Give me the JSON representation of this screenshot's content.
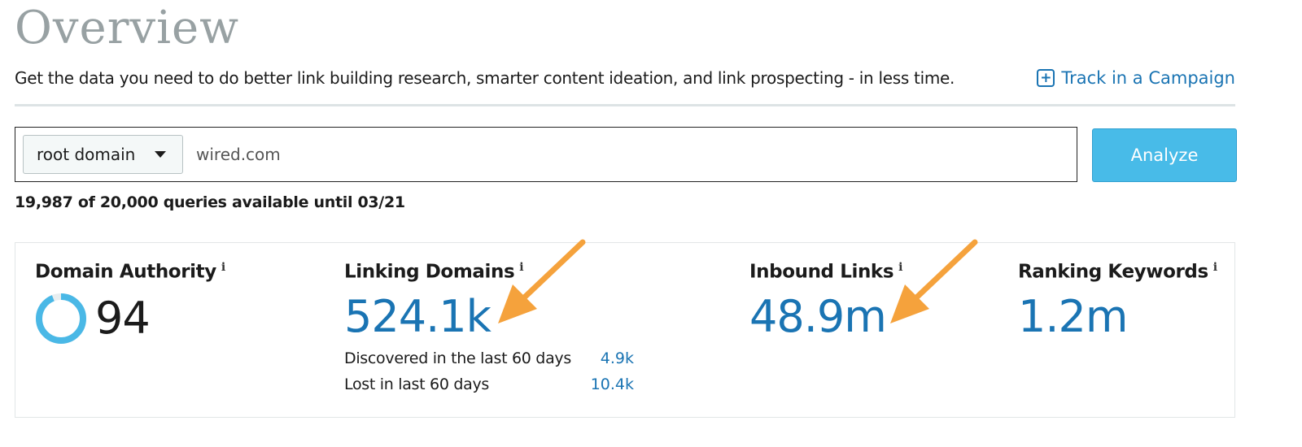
{
  "header": {
    "title": "Overview",
    "subtitle": "Get the data you need to do better link building research, smarter content ideation, and link prospecting - in less time.",
    "track_label": "Track in a Campaign",
    "track_icon": "plus-square-icon"
  },
  "search": {
    "scope_selected": "root domain",
    "query_value": "wired.com",
    "analyze_label": "Analyze"
  },
  "quota": {
    "text": "19,987 of 20,000 queries available until 03/21"
  },
  "metrics": {
    "domain_authority": {
      "label": "Domain Authority",
      "value": "94",
      "score": 94
    },
    "linking_domains": {
      "label": "Linking Domains",
      "value": "524.1k",
      "discovered_label": "Discovered in the last 60 days",
      "discovered_value": "4.9k",
      "lost_label": "Lost in last 60 days",
      "lost_value": "10.4k"
    },
    "inbound_links": {
      "label": "Inbound Links",
      "value": "48.9m"
    },
    "ranking_keywords": {
      "label": "Ranking Keywords",
      "value": "1.2m"
    },
    "info_glyph": "i"
  },
  "colors": {
    "accent_blue": "#1a74b3",
    "button_blue": "#48bbe8",
    "ring_blue": "#4ab8e6",
    "annotation_orange": "#f5a23c",
    "title_gray": "#98a1a3"
  }
}
